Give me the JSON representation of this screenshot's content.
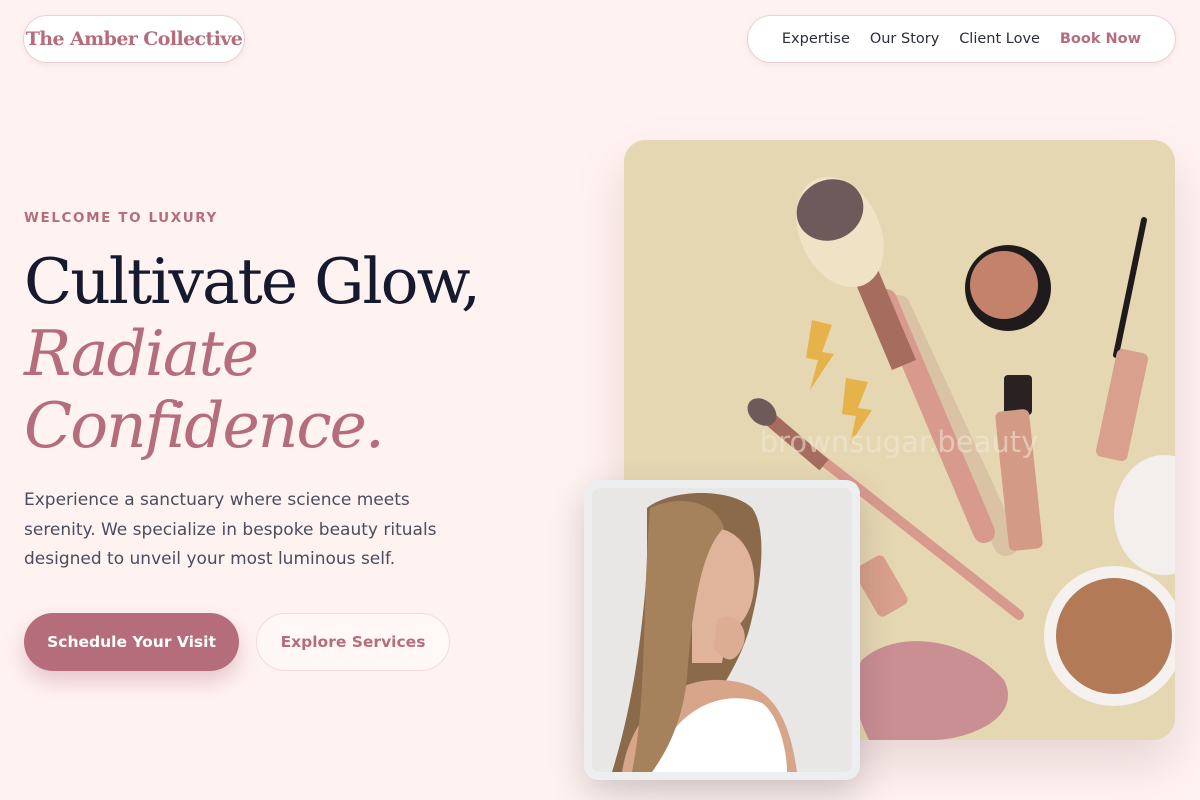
{
  "brand": {
    "name": "The Amber Collective"
  },
  "nav": {
    "items": [
      {
        "label": "Expertise"
      },
      {
        "label": "Our Story"
      },
      {
        "label": "Client Love"
      },
      {
        "label": "Book Now"
      }
    ]
  },
  "hero": {
    "eyebrow": "WELCOME TO LUXURY",
    "title_line1": "Cultivate Glow,",
    "title_line2": "Radiate",
    "title_line3": "Confidence.",
    "description": "Experience a sanctuary where science meets serenity. We specialize in bespoke beauty rituals designed to unveil your most luminous self.",
    "primary_cta": "Schedule Your Visit",
    "secondary_cta": "Explore Services"
  },
  "images": {
    "product_watermark": "brownsugar.beauty"
  },
  "colors": {
    "accent": "#b56d7c",
    "heading": "#161a2e",
    "background": "#fff3f2",
    "card_background": "#e6d7b3"
  }
}
